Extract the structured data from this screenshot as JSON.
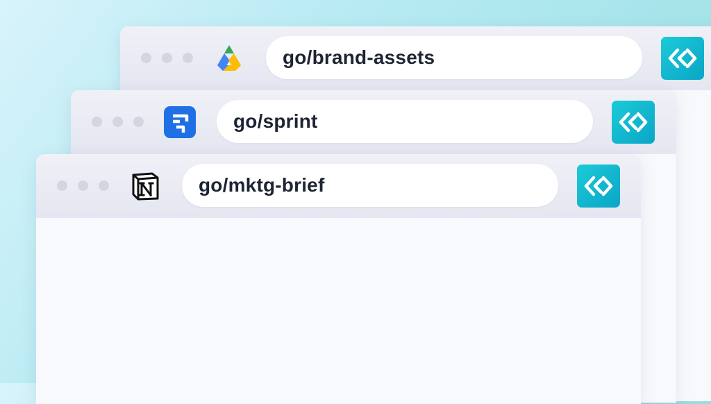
{
  "windows": [
    {
      "url": "go/brand-assets",
      "favicon": "google-drive-icon"
    },
    {
      "url": "go/sprint",
      "favicon": "jira-icon"
    },
    {
      "url": "go/mktg-brief",
      "favicon": "notion-icon"
    }
  ],
  "extension_icon": "golinks-icon",
  "colors": {
    "background_start": "#d8f3fb",
    "background_end": "#9fe0e4",
    "tab_bar": "#e4e6f1",
    "extension_teal": "#0aa6c6",
    "url_text": "#1d2433"
  }
}
